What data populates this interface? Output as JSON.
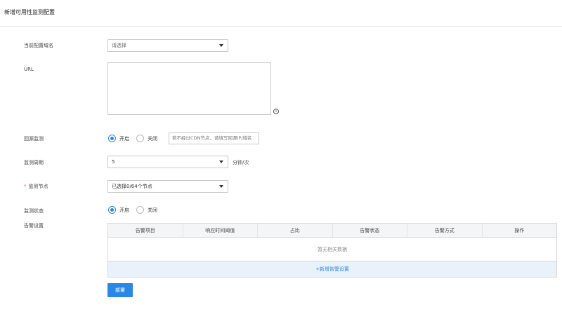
{
  "page": {
    "title": "新增可用性监测配置"
  },
  "form": {
    "domain": {
      "label": "当前配置域名",
      "placeholder": "请选择"
    },
    "url": {
      "label": "URL",
      "info_icon": "info-icon"
    },
    "origin_monitor": {
      "label": "回源监测",
      "options": [
        "开启",
        "关闭"
      ],
      "selected": "开启",
      "input_placeholder": "若不经过CDN节点，请填写回源IP/域名"
    },
    "period": {
      "label": "监测周期",
      "value": "5",
      "unit": "分钟/次"
    },
    "nodes": {
      "label": "监测节点",
      "required_mark": "*",
      "value": "已选择0/64个节点"
    },
    "status": {
      "label": "监测状态",
      "options": [
        "开启",
        "关闭"
      ],
      "selected": "开启"
    },
    "alarm": {
      "label": "告警设置",
      "columns": [
        "告警项目",
        "响应时间阈值",
        "占比",
        "告警状态",
        "告警方式",
        "操作"
      ],
      "empty_text": "暂无相关数据",
      "add_text": "+新增告警设置"
    }
  },
  "actions": {
    "deploy": "部署"
  },
  "colors": {
    "primary": "#2b87e6",
    "required": "#e74c3c",
    "table_header_bg": "#f4f5f7",
    "add_row_bg": "#e9f1fb"
  }
}
